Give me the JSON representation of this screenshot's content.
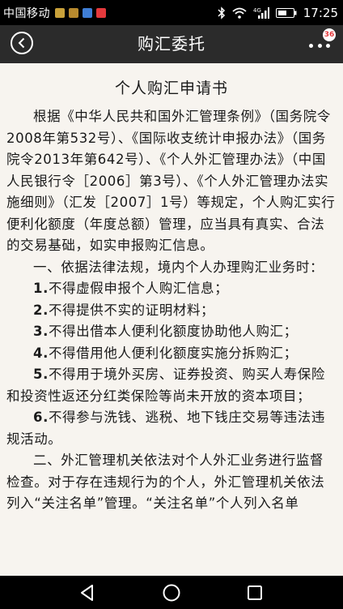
{
  "status_bar": {
    "carrier": "中国移动",
    "time": "17:25",
    "app_icons": [
      "#c9a13a",
      "#b88a2e",
      "#3f7ed6",
      "#e4393c"
    ],
    "signal_label": "4G"
  },
  "header": {
    "title": "购汇委托",
    "badge_count": "36"
  },
  "document": {
    "title": "个人购汇申请书",
    "paragraphs": [
      "根据《中华人民共和国外汇管理条例》（国务院令2008年第532号）、《国际收支统计申报办法》（国务院令2013年第642号）、《个人外汇管理办法》（中国人民银行令［2006］第3号）、《个人外汇管理办法实施细则》（汇发［2007］1号）等规定，个人购汇实行便利化额度（年度总额）管理，应当具有真实、合法的交易基础，如实申报购汇信息。",
      "一、依据法律法规，境内个人办理购汇业务时："
    ],
    "rules": [
      {
        "num": "1.",
        "text": "不得虚假申报个人购汇信息；"
      },
      {
        "num": "2.",
        "text": "不得提供不实的证明材料；"
      },
      {
        "num": "3.",
        "text": "不得出借本人便利化额度协助他人购汇；"
      },
      {
        "num": "4.",
        "text": "不得借用他人便利化额度实施分拆购汇；"
      },
      {
        "num": "5.",
        "text": "不得用于境外买房、证券投资、购买人寿保险和投资性返还分红类保险等尚未开放的资本项目；"
      },
      {
        "num": "6.",
        "text": "不得参与洗钱、逃税、地下钱庄交易等违法违规活动。"
      }
    ],
    "paragraph_after": "二、外汇管理机关依法对个人外汇业务进行监督检查。对于存在违规行为的个人，外汇管理机关依法列入“关注名单”管理。“关注名单”个人列入名单"
  }
}
